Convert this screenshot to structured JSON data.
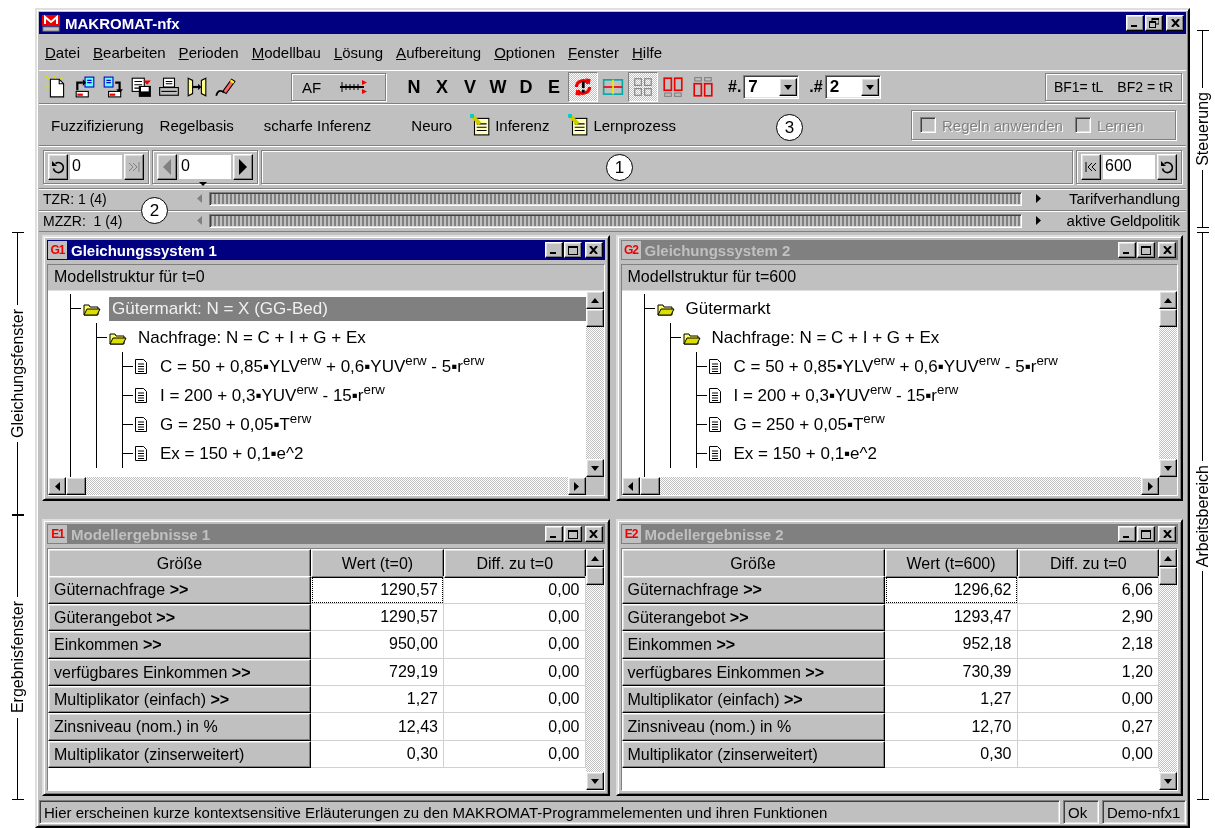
{
  "window": {
    "title": "MAKROMAT-nfx"
  },
  "menu": [
    "Datei",
    "Bearbeiten",
    "Perioden",
    "Modellbau",
    "Lösung",
    "Aufbereitung",
    "Optionen",
    "Fenster",
    "Hilfe"
  ],
  "toolbar": {
    "file_tools": [
      {
        "pressed": false
      },
      {
        "pressed": false
      },
      {
        "pressed": false
      },
      {
        "pressed": false
      },
      {
        "pressed": false
      },
      {
        "pressed": false
      },
      {
        "pressed": false
      }
    ],
    "af_label": "AF",
    "letter_buttons": [
      "N",
      "X",
      "V",
      "W",
      "D",
      "E"
    ],
    "view_tools": [
      {
        "pressed": true
      },
      {
        "pressed": false
      },
      {
        "pressed": true
      },
      {
        "pressed": false
      },
      {
        "pressed": false
      }
    ],
    "combos": [
      {
        "label": "#.",
        "value": "7"
      },
      {
        "label": ".#",
        "value": "2"
      }
    ],
    "shortcut_hints": [
      "BF1= tL",
      "BF2 = tR"
    ]
  },
  "fuzzy_bar": {
    "items": [
      "Fuzzifizierung",
      "Regelbasis",
      "scharfe Inferenz",
      "Neuro"
    ],
    "icon_items": [
      "Inferenz",
      "Lernprozess"
    ],
    "checkboxes": [
      {
        "label": "Regeln anwenden",
        "checked": false,
        "disabled": true
      },
      {
        "label": "Lernen",
        "checked": false,
        "disabled": true
      }
    ]
  },
  "time_bar": {
    "start_value": "0",
    "step_value": "0",
    "end_value": "600",
    "buttons": [
      {
        "disabled": false
      },
      {
        "disabled": true
      },
      {
        "disabled": true
      },
      {
        "disabled": false
      },
      {
        "disabled": false
      },
      {
        "disabled": false
      }
    ]
  },
  "tracks": [
    {
      "label": "TZR: 1 (4)",
      "event": "Tarifverhandlung"
    },
    {
      "label": "MZZR:  1 (4)",
      "event": "aktive Geldpolitik"
    }
  ],
  "equation_windows": [
    {
      "badge": "G1",
      "title": "Gleichungssystem 1",
      "active": true,
      "header": "Modellstruktur für t=0",
      "tree": [
        {
          "label": "Gütermarkt: N = X (GG-Bed)",
          "selected": true,
          "children": [
            {
              "label": "Nachfrage: N = C + I + G + Ex",
              "selected": false,
              "children": [
                {
                  "label": "C = 50 + 0,85▪YLV$^{erw}$ + 0,6▪YUV$^{erw}$ - 5▪r$^{erw}$",
                  "selected": false
                },
                {
                  "label": "I = 200 + 0,3▪YUV$^{erw}$ - 15▪r$^{erw}$",
                  "selected": false
                },
                {
                  "label": "G = 250 + 0,05▪T$^{erw}$",
                  "selected": false
                },
                {
                  "label": "Ex = 150 + 0,1▪e^2",
                  "selected": false
                }
              ]
            }
          ]
        }
      ]
    },
    {
      "badge": "G2",
      "title": "Gleichungssystem 2",
      "active": false,
      "header": "Modellstruktur für t=600",
      "tree": [
        {
          "label": "Gütermarkt",
          "selected": false,
          "children": [
            {
              "label": "Nachfrage: N = C + I + G + Ex",
              "selected": false,
              "children": [
                {
                  "label": "C = 50 + 0,85▪YLV$^{erw}$ + 0,6▪YUV$^{erw}$ - 5▪r$^{erw}$",
                  "selected": false
                },
                {
                  "label": "I = 200 + 0,3▪YUV$^{erw}$ - 15▪r$^{erw}$",
                  "selected": false
                },
                {
                  "label": "G = 250 + 0,05▪T$^{erw}$",
                  "selected": false
                },
                {
                  "label": "Ex = 150 + 0,1▪e^2",
                  "selected": false
                }
              ]
            }
          ]
        }
      ]
    }
  ],
  "result_windows": [
    {
      "badge": "E1",
      "title": "Modellergebnisse 1",
      "active": false,
      "columns": [
        "Größe",
        "Wert (t=0)",
        "Diff. zu t=0"
      ],
      "rows": [
        {
          "name": "Güternachfrage **>>**",
          "value": "1290,57",
          "diff": "0,00",
          "focused": true
        },
        {
          "name": "Güterangebot **>>**",
          "value": "1290,57",
          "diff": "0,00",
          "focused": false
        },
        {
          "name": "Einkommen **>>**",
          "value": "950,00",
          "diff": "0,00",
          "focused": false
        },
        {
          "name": "verfügbares Einkommen **>>**",
          "value": "729,19",
          "diff": "0,00",
          "focused": false
        },
        {
          "name": "Multiplikator (einfach) **>>**",
          "value": "1,27",
          "diff": "0,00",
          "focused": false
        },
        {
          "name": "Zinsniveau (nom.) in %",
          "value": "12,43",
          "diff": "0,00",
          "focused": false
        },
        {
          "name": "Multiplikator (zinserweitert)",
          "value": "0,30",
          "diff": "0,00",
          "focused": false
        }
      ]
    },
    {
      "badge": "E2",
      "title": "Modellergebnisse 2",
      "active": false,
      "columns": [
        "Größe",
        "Wert (t=600)",
        "Diff. zu t=0"
      ],
      "rows": [
        {
          "name": "Güternachfrage **>>**",
          "value": "1296,62",
          "diff": "6,06",
          "focused": true
        },
        {
          "name": "Güterangebot **>>**",
          "value": "1293,47",
          "diff": "2,90",
          "focused": false
        },
        {
          "name": "Einkommen **>>**",
          "value": "952,18",
          "diff": "2,18",
          "focused": false
        },
        {
          "name": "verfügbares Einkommen **>>**",
          "value": "730,39",
          "diff": "1,20",
          "focused": false
        },
        {
          "name": "Multiplikator (einfach) **>>**",
          "value": "1,27",
          "diff": "0,00",
          "focused": false
        },
        {
          "name": "Zinsniveau (nom.) in %",
          "value": "12,70",
          "diff": "0,27",
          "focused": false
        },
        {
          "name": "Multiplikator (zinserweitert)",
          "value": "0,30",
          "diff": "0,00",
          "focused": false
        }
      ]
    }
  ],
  "status_bar": {
    "message": "Hier erscheinen kurze kontextsensitive Erläuterungen zu den MAKROMAT-Programmelementen und ihren Funktionen",
    "state": "Ok",
    "mode": "Demo-nfx1"
  },
  "callouts": [
    "1",
    "2",
    "3"
  ],
  "annotations": {
    "left": [
      "Gleichungsfenster",
      "Ergebnisfenster"
    ],
    "right": [
      "Steuerung",
      "Arbeitsbereich"
    ]
  }
}
